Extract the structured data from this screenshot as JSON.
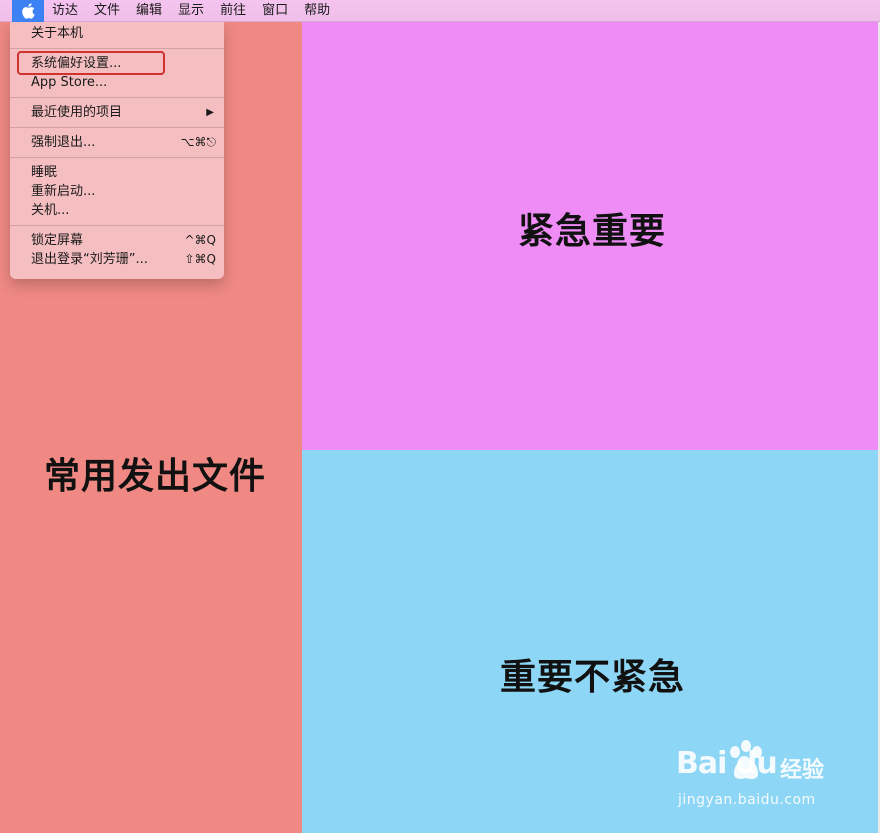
{
  "menubar": {
    "apple_icon": "apple-icon",
    "items": [
      {
        "label": "访达"
      },
      {
        "label": "文件"
      },
      {
        "label": "编辑"
      },
      {
        "label": "显示"
      },
      {
        "label": "前往"
      },
      {
        "label": "窗口"
      },
      {
        "label": "帮助"
      }
    ]
  },
  "apple_menu": {
    "about": "关于本机",
    "system_prefs": "系统偏好设置...",
    "app_store": "App Store...",
    "recent_items": "最近使用的项目",
    "force_quit": "强制退出...",
    "force_quit_shortcut": "⌥⌘⎋",
    "sleep": "睡眠",
    "restart": "重新启动...",
    "shutdown": "关机...",
    "lock_screen": "锁定屏幕",
    "lock_screen_shortcut": "^⌘Q",
    "logout": "退出登录“刘芳珊”...",
    "logout_shortcut": "⇧⌘Q"
  },
  "panels": {
    "left": "常用发出文件",
    "top_right": "紧急重要",
    "bottom_right": "重要不紧急"
  },
  "colors": {
    "left_panel": "#f08984",
    "top_right_panel": "#ef8cf6",
    "bottom_right_panel": "#8ed6f5",
    "menubar": "#f4c3ef",
    "apple_button": "#3d82f5",
    "highlight": "#d0332f"
  },
  "watermark": {
    "logo": "Bai du",
    "cn": "经验",
    "url": "jingyan.baidu.com"
  }
}
